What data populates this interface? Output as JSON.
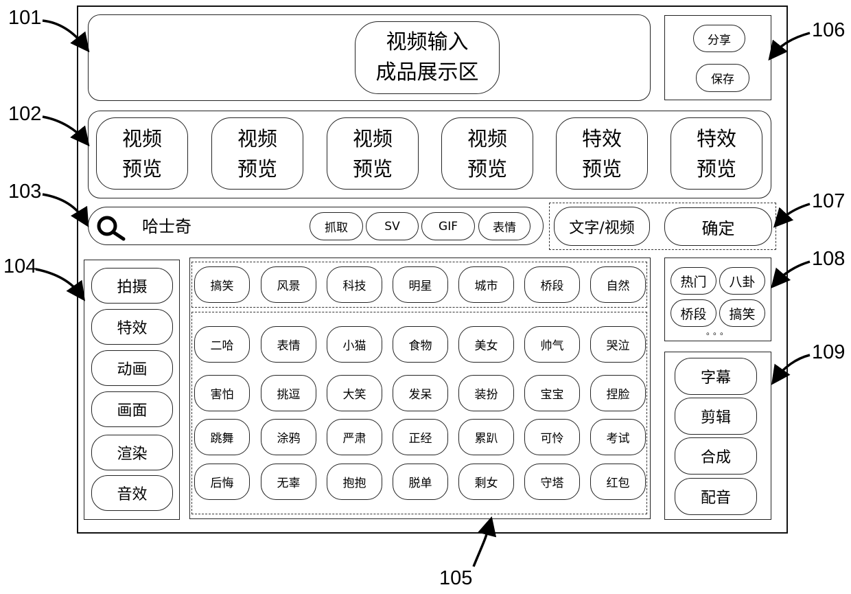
{
  "callouts": {
    "c101": "101",
    "c102": "102",
    "c103": "103",
    "c104": "104",
    "c105": "105",
    "c106": "106",
    "c107": "107",
    "c108": "108",
    "c109": "109"
  },
  "display_area": {
    "line1": "视频输入",
    "line2": "成品展示区"
  },
  "share_save": {
    "share_label": "分享",
    "save_label": "保存"
  },
  "previews": [
    {
      "line1": "视频",
      "line2": "预览"
    },
    {
      "line1": "视频",
      "line2": "预览"
    },
    {
      "line1": "视频",
      "line2": "预览"
    },
    {
      "line1": "视频",
      "line2": "预览"
    },
    {
      "line1": "特效",
      "line2": "预览"
    },
    {
      "line1": "特效",
      "line2": "预览"
    }
  ],
  "search": {
    "icon": "search-icon",
    "value": "哈士奇",
    "filters": [
      "抓取",
      "SV",
      "GIF",
      "表情"
    ]
  },
  "actions": {
    "text_video_label": "文字/视频",
    "confirm_label": "确定"
  },
  "left_menu": [
    "拍摄",
    "特效",
    "动画",
    "画面",
    "渲染",
    "音效"
  ],
  "categories": [
    "搞笑",
    "风景",
    "科技",
    "明星",
    "城市",
    "桥段",
    "自然"
  ],
  "tags": [
    [
      "二哈",
      "表情",
      "小猫",
      "食物",
      "美女",
      "帅气",
      "哭泣"
    ],
    [
      "害怕",
      "挑逗",
      "大笑",
      "发呆",
      "装扮",
      "宝宝",
      "捏脸"
    ],
    [
      "跳舞",
      "涂鸦",
      "严肃",
      "正经",
      "累趴",
      "可怜",
      "考试"
    ],
    [
      "后悔",
      "无辜",
      "抱抱",
      "脱单",
      "剩女",
      "守塔",
      "红包"
    ]
  ],
  "hot_tags": {
    "items": [
      "热门",
      "八卦",
      "桥段",
      "搞笑"
    ],
    "more": "。。。"
  },
  "edit_menu": [
    "字幕",
    "剪辑",
    "合成",
    "配音"
  ]
}
